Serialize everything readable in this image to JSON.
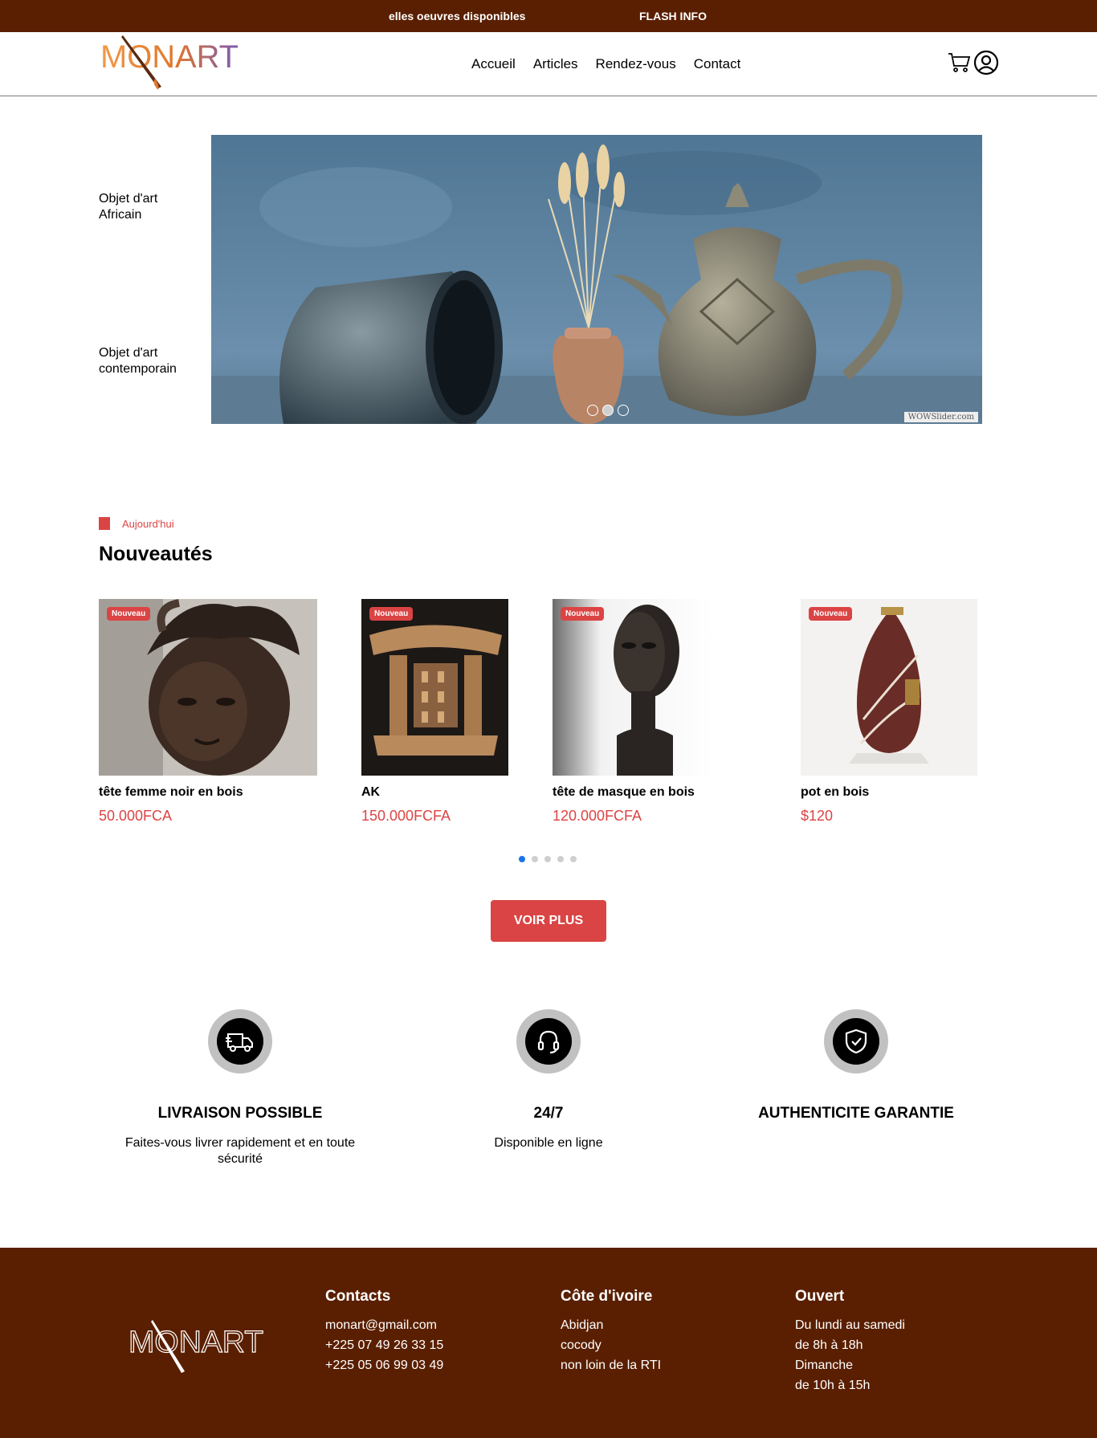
{
  "flashbar": {
    "marquee_text": "elles oeuvres disponibles",
    "flash_label": "FLASH INFO"
  },
  "header": {
    "logo_text": "MONART",
    "nav": [
      {
        "label": "Accueil"
      },
      {
        "label": "Articles"
      },
      {
        "label": "Rendez-vous"
      },
      {
        "label": "Contact"
      }
    ],
    "icons": [
      "cart-icon",
      "user-icon"
    ]
  },
  "hero": {
    "categories": [
      {
        "label": "Objet d'art Africain"
      },
      {
        "label": "Objet d'art contemporain"
      }
    ],
    "slider": {
      "slide_count": 3,
      "active_slide": 2,
      "watermark": "WOWSlider.com"
    }
  },
  "section": {
    "eyebrow": "Aujourd'hui",
    "title": "Nouveautés"
  },
  "products": [
    {
      "badge": "Nouveau",
      "name": "tête femme noir en bois",
      "price": "50.000FCA"
    },
    {
      "badge": "Nouveau",
      "name": "AK",
      "price": "150.000FCFA"
    },
    {
      "badge": "Nouveau",
      "name": "tête de masque en bois",
      "price": "120.000FCFA"
    },
    {
      "badge": "Nouveau",
      "name": "pot en bois",
      "price": "$120"
    }
  ],
  "pager": {
    "count": 5,
    "active": 1
  },
  "cta": {
    "label": "VOIR PLUS"
  },
  "features": [
    {
      "icon": "truck-icon",
      "title": "LIVRAISON POSSIBLE",
      "desc": "Faites-vous livrer rapidement et en toute sécurité"
    },
    {
      "icon": "headset-icon",
      "title": "24/7",
      "desc": "Disponible en ligne"
    },
    {
      "icon": "shield-check-icon",
      "title": "AUTHENTICITE GARANTIE",
      "desc": ""
    }
  ],
  "footer": {
    "logo_text": "MONART",
    "contacts": {
      "title": "Contacts",
      "lines": [
        "monart@gmail.com",
        "+225 07 49 26 33 15",
        "+225 05 06 99 03 49"
      ]
    },
    "location": {
      "title": "Côte d'ivoire",
      "lines": [
        "Abidjan",
        "cocody",
        "non loin de la RTI"
      ]
    },
    "hours": {
      "title": "Ouvert",
      "lines": [
        "Du lundi au samedi",
        "de 8h à 18h",
        "Dimanche",
        "de 10h à 15h"
      ]
    }
  },
  "colors": {
    "brand_brown": "#5a1f00",
    "accent_red": "#db4444",
    "pager_active": "#1b74e4"
  }
}
